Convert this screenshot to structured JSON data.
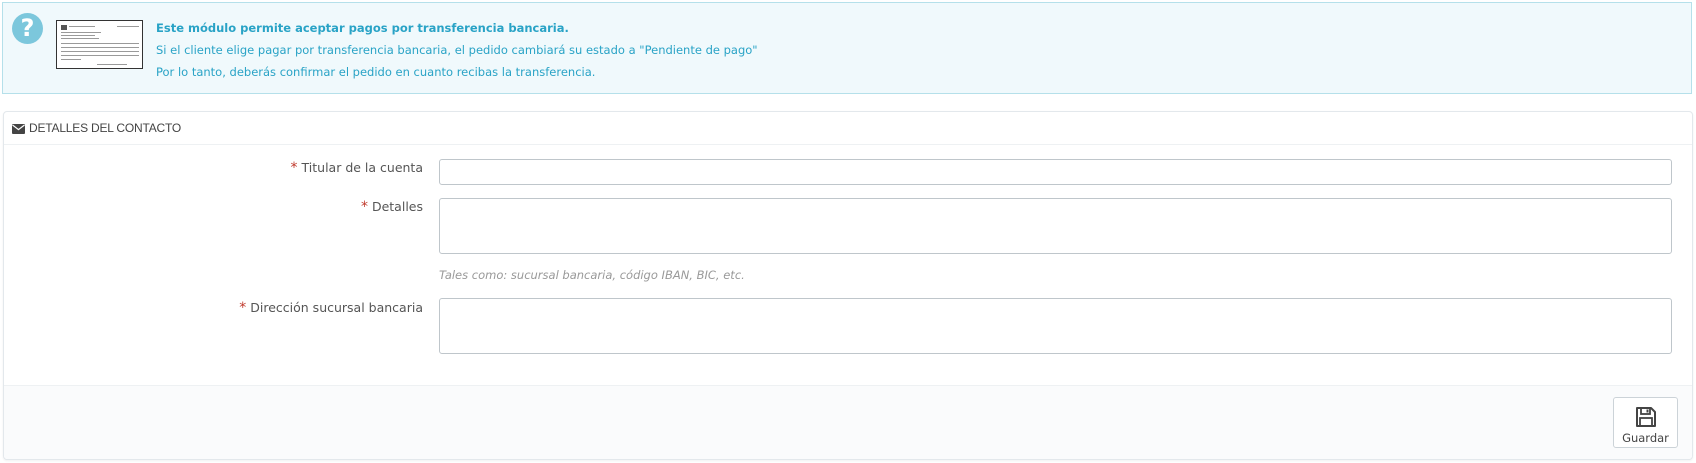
{
  "info": {
    "icon": "question-circle-icon",
    "lead": "Este módulo permite aceptar pagos por transferencia bancaria.",
    "line2": "Si el cliente elige pagar por transferencia bancaria, el pedido cambiará su estado a \"Pendiente de pago\"",
    "line3": "Por lo tanto, deberás confirmar el pedido en cuanto recibas la transferencia.",
    "accent": "#29a3c6"
  },
  "panel": {
    "icon": "envelope-icon",
    "title": "DETALLES DEL CONTACTO"
  },
  "form": {
    "required_mark": "*",
    "owner_label": "Titular de la cuenta",
    "owner_value": "",
    "details_label": "Detalles",
    "details_value": "",
    "details_help": "Tales como: sucursal bancaria, código IBAN, BIC, etc.",
    "address_label": "Dirección sucursal bancaria",
    "address_value": ""
  },
  "footer": {
    "save_icon": "floppy-disk-icon",
    "save_label": "Guardar"
  }
}
